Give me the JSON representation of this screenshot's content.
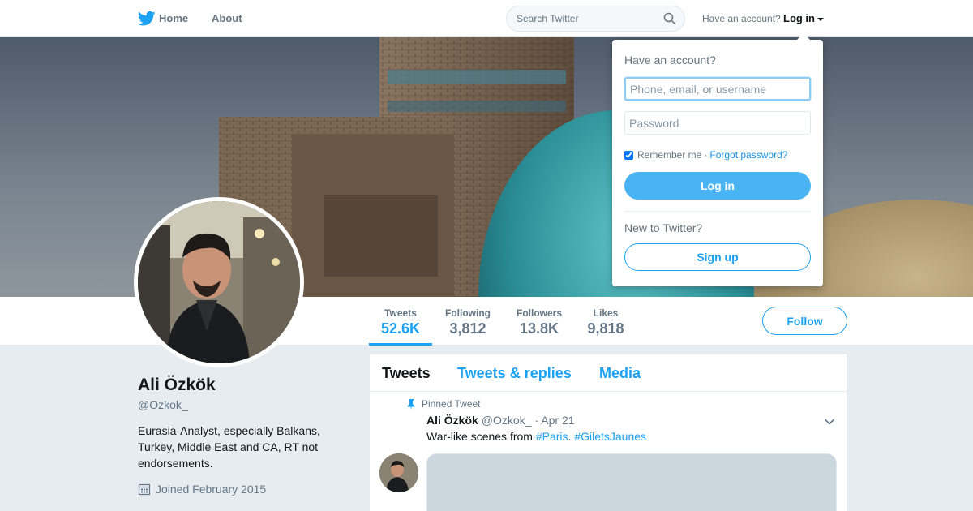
{
  "nav": {
    "home_label": "Home",
    "about_label": "About",
    "search_placeholder": "Search Twitter",
    "account_prompt": "Have an account?",
    "login_label": "Log in"
  },
  "profile": {
    "name": "Ali Özkök",
    "handle": "@Ozkok_",
    "bio": "Eurasia-Analyst, especially Balkans, Turkey, Middle East and CA, RT not endorsements.",
    "joined": "Joined February 2015"
  },
  "stats": [
    {
      "label": "Tweets",
      "value": "52.6K"
    },
    {
      "label": "Following",
      "value": "3,812"
    },
    {
      "label": "Followers",
      "value": "13.8K"
    },
    {
      "label": "Likes",
      "value": "9,818"
    }
  ],
  "follow_label": "Follow",
  "timeline": {
    "tabs": [
      "Tweets",
      "Tweets & replies",
      "Media"
    ],
    "tweet": {
      "pinned_label": "Pinned Tweet",
      "name": "Ali Özkök",
      "handle": "@Ozkok_",
      "date": "· Apr 21",
      "text_prefix": "War-like scenes from ",
      "hashtag1": "#Paris",
      "separator": ". ",
      "hashtag2": "#GiletsJaunes"
    }
  },
  "login_dropdown": {
    "title": "Have an account?",
    "username_placeholder": "Phone, email, or username",
    "password_placeholder": "Password",
    "remember_label": "Remember me",
    "dot": "·",
    "forgot_label": "Forgot password?",
    "login_button": "Log in",
    "new_prompt": "New to Twitter?",
    "signup_button": "Sign up"
  },
  "colors": {
    "accent": "#1da1f2",
    "login_button": "#4ab3f4",
    "background": "#e6ecf0"
  }
}
